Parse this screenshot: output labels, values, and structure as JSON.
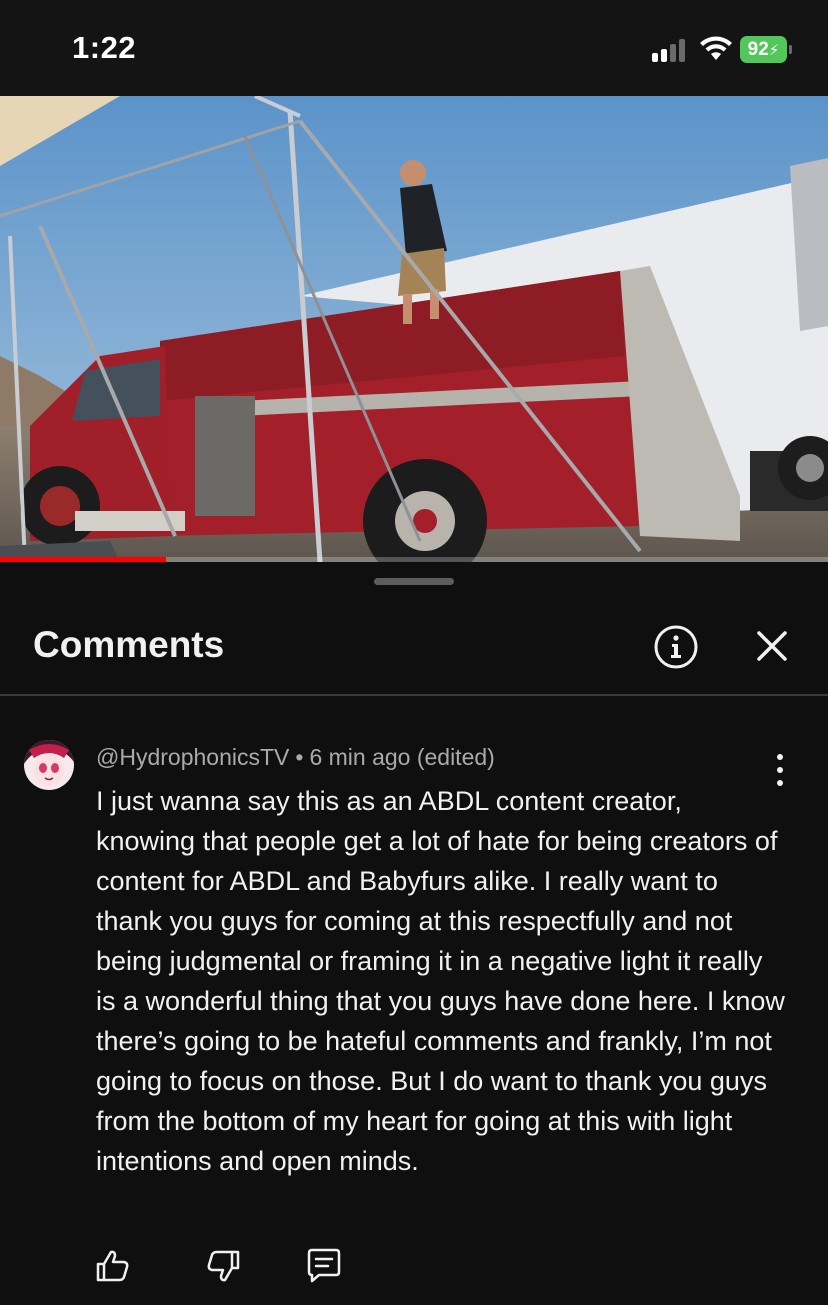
{
  "status_bar": {
    "time": "1:22",
    "battery_percent": "92",
    "signal_bars_active": 2,
    "signal_bars_total": 4,
    "battery_color": "#53c85a"
  },
  "video": {
    "progress_fraction": 0.2,
    "progress_color": "#ff0000"
  },
  "comments_panel": {
    "title": "Comments",
    "info_icon": "info-circle-icon",
    "close_icon": "close-icon"
  },
  "comments": [
    {
      "author": "@HydrophonicsTV",
      "separator": "•",
      "time": "6 min ago (edited)",
      "text": "I just wanna say this as an ABDL content creator, knowing that people get a lot of hate for being creators of content for ABDL and Babyfurs alike. I really want to thank you guys for coming at this respectfully and not being judgmental or framing it in a negative light it really is a wonderful thing that you guys have done here. I know there’s going to be hateful comments and frankly, I’m not going to focus on those. But I do want to thank you guys from the bottom of my heart for going at this with light intentions and open minds.",
      "actions": [
        "thumbs-up-icon",
        "thumbs-down-icon",
        "reply-icon"
      ]
    }
  ]
}
